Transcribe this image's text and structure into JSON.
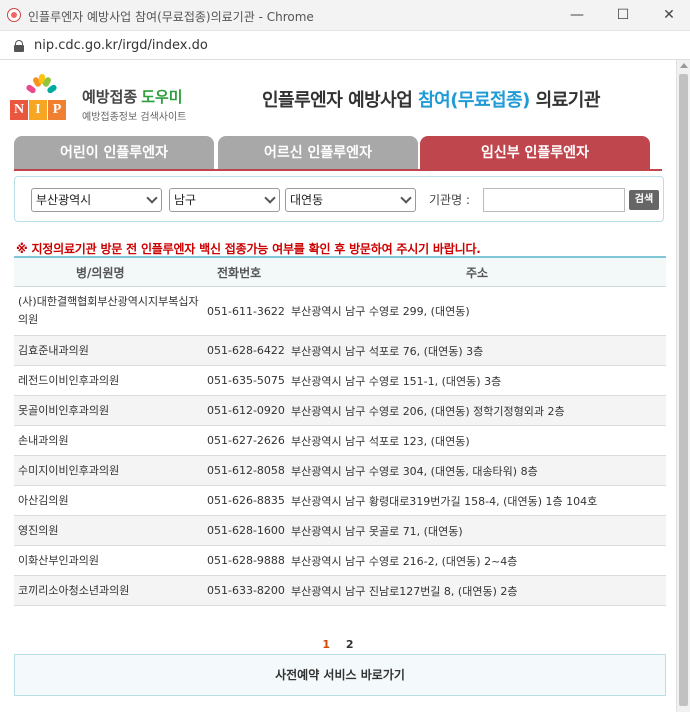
{
  "window": {
    "title": "인플루엔자 예방사업 참여(무료접종)의료기관 - Chrome",
    "minimize": "—",
    "maximize": "☐",
    "close": "✕"
  },
  "address_bar": {
    "url": "nip.cdc.go.kr/irgd/index.do"
  },
  "header": {
    "logo_letters": [
      "N",
      "I",
      "P"
    ],
    "brand_main": "예방접종",
    "brand_accent": "도우미",
    "brand_sub": "예방접종정보 검색사이트",
    "title_pre": "인플루엔자 예방사업 ",
    "title_hl": "참여(무료접종)",
    "title_post": " 의료기관"
  },
  "tabs": [
    {
      "label": "어린이 인플루엔자",
      "active": false
    },
    {
      "label": "어르신 인플루엔자",
      "active": false
    },
    {
      "label": "임신부  인플루엔자",
      "active": true
    }
  ],
  "search": {
    "city": "부산광역시",
    "district": "남구",
    "dong": "대연동",
    "org_label": "기관명 :",
    "org_value": "",
    "button": "검색"
  },
  "notice": "※ 지정의료기관 방문 전 인플루엔자 백신 접종가능 여부를 확인 후 방문하여 주시기 바랍니다.",
  "table": {
    "headers": {
      "name": "병/의원명",
      "tel": "전화번호",
      "addr": "주소"
    },
    "rows": [
      {
        "name": "(사)대한결핵협회부산광역시지부복십자의원",
        "tel": "051-611-3622",
        "addr": "부산광역시 남구 수영로 299, (대연동)"
      },
      {
        "name": "김효준내과의원",
        "tel": "051-628-6422",
        "addr": "부산광역시 남구 석포로 76, (대연동) 3층"
      },
      {
        "name": "레전드이비인후과의원",
        "tel": "051-635-5075",
        "addr": "부산광역시 남구 수영로 151-1, (대연동) 3층"
      },
      {
        "name": "못골이비인후과의원",
        "tel": "051-612-0920",
        "addr": "부산광역시 남구 수영로 206, (대연동) 정학기정형외과 2층"
      },
      {
        "name": "손내과의원",
        "tel": "051-627-2626",
        "addr": "부산광역시 남구 석포로 123, (대연동)"
      },
      {
        "name": "수미지이비인후과의원",
        "tel": "051-612-8058",
        "addr": "부산광역시 남구 수영로 304, (대연동, 대송타워) 8층"
      },
      {
        "name": "아산김의원",
        "tel": "051-626-8835",
        "addr": "부산광역시 남구 황령대로319번가길 158-4, (대연동) 1층 104호"
      },
      {
        "name": "영진의원",
        "tel": "051-628-1600",
        "addr": "부산광역시 남구 못골로 71, (대연동)"
      },
      {
        "name": "이화산부인과의원",
        "tel": "051-628-9888",
        "addr": "부산광역시 남구 수영로 216-2, (대연동) 2~4층"
      },
      {
        "name": "코끼리소아청소년과의원",
        "tel": "051-633-8200",
        "addr": "부산광역시 남구 진남로127번길 8, (대연동) 2층"
      }
    ]
  },
  "pagination": {
    "current": "1",
    "pages": [
      "2"
    ]
  },
  "reserve_button": "사전예약 서비스 바로가기",
  "colors": {
    "active_tab": "#c0464e",
    "inactive_tab": "#a8a8a8",
    "notice": "#cc0000",
    "brand_accent": "#2e9e3e",
    "title_highlight": "#1f9bd6",
    "table_border": "#7fc5d4"
  }
}
